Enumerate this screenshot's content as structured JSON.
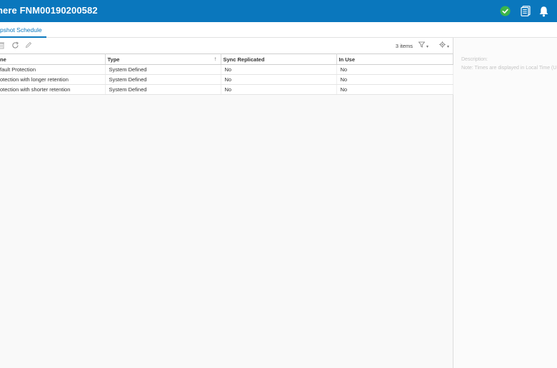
{
  "header": {
    "title": "here FNM00190200582",
    "icons": [
      "check-circle-icon",
      "document-list-icon",
      "bell-icon"
    ],
    "bg_color": "#0a77bd",
    "status_color": "#3cb54a"
  },
  "tabs": [
    {
      "label": "pshot Schedule",
      "active": true
    }
  ],
  "toolbar": {
    "icons": [
      "delete-icon",
      "refresh-icon",
      "edit-icon"
    ],
    "items_count": "3 items",
    "filter_caret": "▾",
    "gear_caret": "▾"
  },
  "table": {
    "columns": [
      "ne",
      "Type",
      "Sync Replicated",
      "In Use"
    ],
    "sorted_column": "Type",
    "rows": [
      [
        "fault Protection",
        "System Defined",
        "No",
        "No"
      ],
      [
        "otection with longer retention",
        "System Defined",
        "No",
        "No"
      ],
      [
        "otection with shorter retention",
        "System Defined",
        "No",
        "No"
      ]
    ]
  },
  "side_panel": {
    "description_label": "Description:",
    "note": "Note: Times are displayed in Local Time (U"
  }
}
